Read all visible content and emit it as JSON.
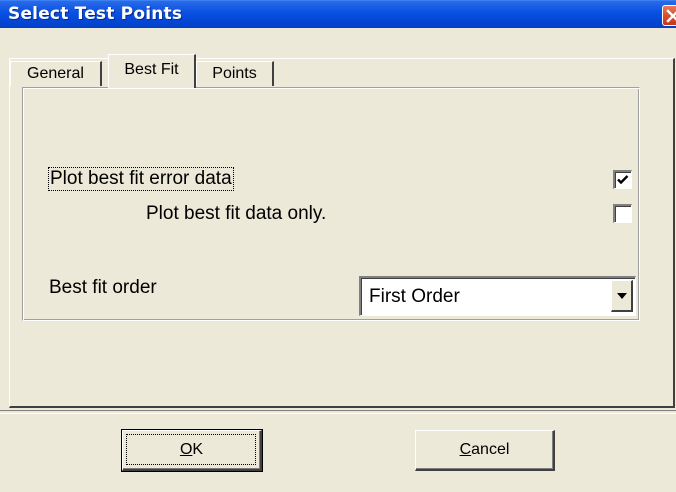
{
  "window": {
    "title": "Select Test Points",
    "close_icon": "close-icon"
  },
  "tabs": [
    {
      "label": "General",
      "active": false
    },
    {
      "label": "Best Fit",
      "active": true
    },
    {
      "label": "Points",
      "active": false
    }
  ],
  "best_fit": {
    "plot_error_data": {
      "label": "Plot best fit error data",
      "checked": true
    },
    "plot_data_only": {
      "label": "Plot best fit data only.",
      "checked": false
    },
    "order": {
      "label": "Best fit order",
      "value": "First Order"
    }
  },
  "buttons": {
    "ok_accel": "O",
    "ok_rest": "K",
    "cancel_accel": "C",
    "cancel_rest": "ancel"
  },
  "colors": {
    "titlebar": "#0a52e3",
    "dialog_bg": "#ece9d8",
    "close": "#d9502f"
  }
}
